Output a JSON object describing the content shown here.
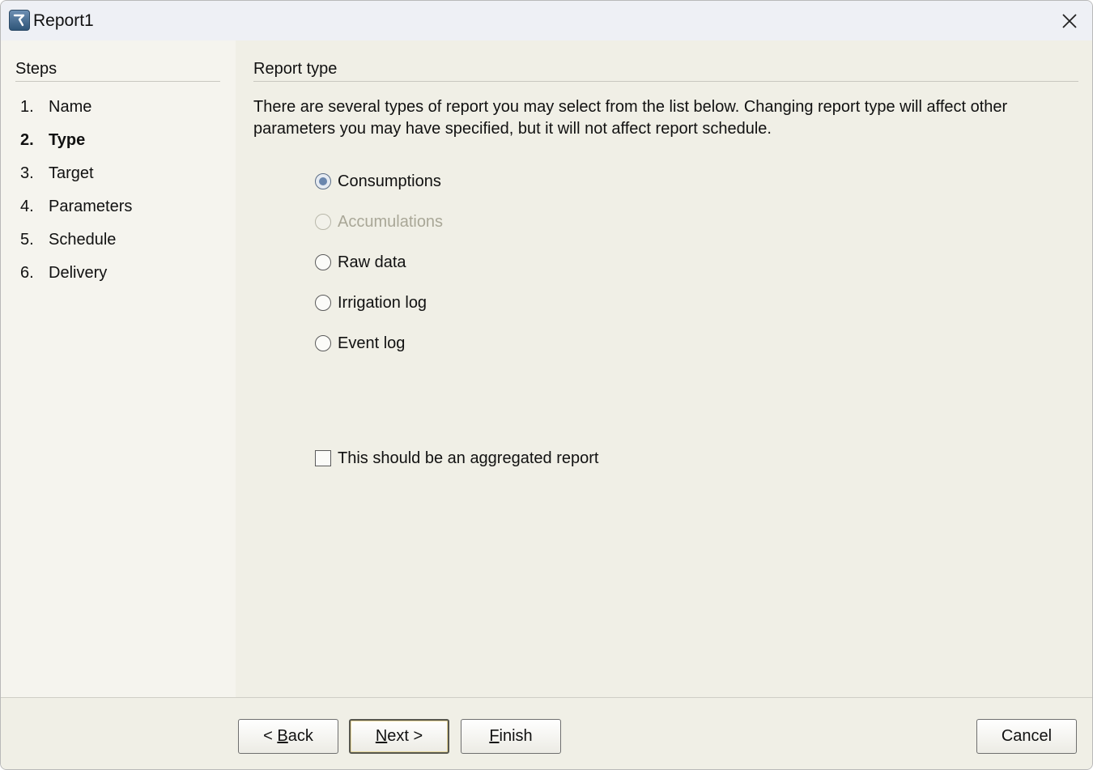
{
  "window": {
    "title": "Report1"
  },
  "sidebar": {
    "heading": "Steps",
    "steps": [
      {
        "num": "1.",
        "label": "Name"
      },
      {
        "num": "2.",
        "label": "Type"
      },
      {
        "num": "3.",
        "label": "Target"
      },
      {
        "num": "4.",
        "label": "Parameters"
      },
      {
        "num": "5.",
        "label": "Schedule"
      },
      {
        "num": "6.",
        "label": "Delivery"
      }
    ],
    "active_step": "Type"
  },
  "main": {
    "heading": "Report type",
    "description": "There are several types of report you may select from the list below. Changing report type will affect other parameters you may have specified, but it will not affect report schedule.",
    "report_types": [
      {
        "label": "Consumptions",
        "selected": true,
        "enabled": true
      },
      {
        "label": "Accumulations",
        "selected": false,
        "enabled": false
      },
      {
        "label": "Raw data",
        "selected": false,
        "enabled": true
      },
      {
        "label": "Irrigation log",
        "selected": false,
        "enabled": true
      },
      {
        "label": "Event log",
        "selected": false,
        "enabled": true
      }
    ],
    "aggregated_checkbox": {
      "label": "This should be an aggregated report",
      "checked": false
    }
  },
  "footer": {
    "back": {
      "pre": "< ",
      "mnemonic": "B",
      "rest": "ack"
    },
    "next": {
      "mnemonic": "N",
      "rest": "ext >"
    },
    "finish": {
      "mnemonic": "F",
      "rest": "inish"
    },
    "cancel": "Cancel"
  }
}
